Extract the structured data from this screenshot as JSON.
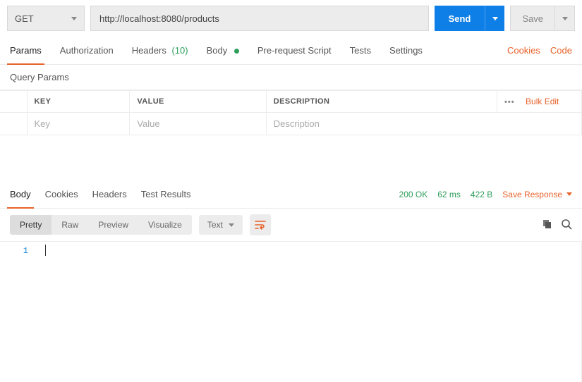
{
  "request": {
    "method": "GET",
    "url": "http://localhost:8080/products",
    "send_label": "Send",
    "save_label": "Save"
  },
  "tabs": {
    "params": "Params",
    "authorization": "Authorization",
    "headers": "Headers",
    "headers_count": "(10)",
    "body": "Body",
    "prerequest": "Pre-request Script",
    "tests": "Tests",
    "settings": "Settings",
    "cookies": "Cookies",
    "code": "Code"
  },
  "query_params": {
    "title": "Query Params",
    "headers": {
      "key": "KEY",
      "value": "VALUE",
      "description": "DESCRIPTION"
    },
    "placeholders": {
      "key": "Key",
      "value": "Value",
      "description": "Description"
    },
    "bulk_edit": "Bulk Edit"
  },
  "response": {
    "tabs": {
      "body": "Body",
      "cookies": "Cookies",
      "headers": "Headers",
      "test_results": "Test Results"
    },
    "status": "200 OK",
    "time": "62 ms",
    "size": "422 B",
    "save_response": "Save Response"
  },
  "viewer": {
    "pretty": "Pretty",
    "raw": "Raw",
    "preview": "Preview",
    "visualize": "Visualize",
    "format": "Text",
    "line_number": "1"
  }
}
